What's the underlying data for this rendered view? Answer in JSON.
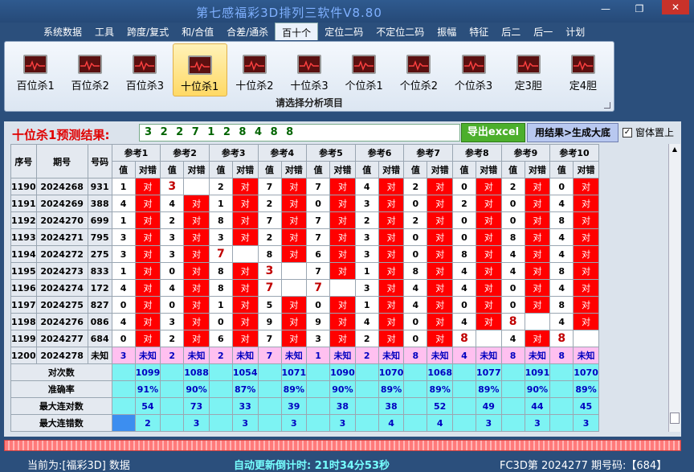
{
  "window": {
    "title": "第七感福彩3D排列三软件V8.80"
  },
  "menu": [
    "系统数据",
    "工具",
    "跨度/复式",
    "和/合值",
    "合差/通杀",
    "百十个",
    "定位二码",
    "不定位二码",
    "振幅",
    "特征",
    "后二",
    "后一",
    "计划"
  ],
  "menu_active": "百十个",
  "ribbon": {
    "buttons": [
      "百位杀1",
      "百位杀2",
      "百位杀3",
      "十位杀1",
      "十位杀2",
      "十位杀3",
      "个位杀1",
      "个位杀2",
      "个位杀3",
      "定3胆",
      "定4胆"
    ],
    "active": "十位杀1",
    "caption": "请选择分析项目"
  },
  "result": {
    "title": "十位杀1预测结果:",
    "value": "3 2 2 7 1 2 8 4 8 8",
    "export_label": "导出excel",
    "generate_label": "用结果>生成大底",
    "ontop_label": "窗体置上",
    "ontop_checked": true
  },
  "table": {
    "headers": {
      "seq": "序号",
      "period": "期号",
      "number": "号码",
      "value": "值",
      "result": "对错"
    },
    "refs": [
      "参考1",
      "参考2",
      "参考3",
      "参考4",
      "参考5",
      "参考6",
      "参考7",
      "参考8",
      "参考9",
      "参考10"
    ],
    "rows": [
      {
        "seq": "1190",
        "period": "2024268",
        "number": "931",
        "vals": [
          "1",
          "3",
          "2",
          "7",
          "7",
          "4",
          "2",
          "0",
          "2",
          "0"
        ]
      },
      {
        "seq": "1191",
        "period": "2024269",
        "number": "388",
        "vals": [
          "4",
          "4",
          "1",
          "2",
          "0",
          "3",
          "0",
          "2",
          "0",
          "4"
        ]
      },
      {
        "seq": "1192",
        "period": "2024270",
        "number": "699",
        "vals": [
          "1",
          "2",
          "8",
          "7",
          "7",
          "2",
          "2",
          "0",
          "0",
          "8"
        ]
      },
      {
        "seq": "1193",
        "period": "2024271",
        "number": "795",
        "vals": [
          "3",
          "3",
          "3",
          "2",
          "7",
          "3",
          "0",
          "0",
          "8",
          "4"
        ]
      },
      {
        "seq": "1194",
        "period": "2024272",
        "number": "275",
        "vals": [
          "3",
          "3",
          "7",
          "8",
          "6",
          "3",
          "0",
          "8",
          "4",
          "4"
        ]
      },
      {
        "seq": "1195",
        "period": "2024273",
        "number": "833",
        "vals": [
          "1",
          "0",
          "8",
          "3",
          "7",
          "1",
          "8",
          "4",
          "4",
          "8"
        ]
      },
      {
        "seq": "1196",
        "period": "2024274",
        "number": "172",
        "vals": [
          "4",
          "4",
          "8",
          "7",
          "7",
          "3",
          "4",
          "4",
          "0",
          "4"
        ]
      },
      {
        "seq": "1197",
        "period": "2024275",
        "number": "827",
        "vals": [
          "0",
          "0",
          "1",
          "5",
          "0",
          "1",
          "4",
          "0",
          "0",
          "8"
        ]
      },
      {
        "seq": "1198",
        "period": "2024276",
        "number": "086",
        "vals": [
          "4",
          "3",
          "0",
          "9",
          "9",
          "4",
          "0",
          "4",
          "8",
          "4"
        ]
      },
      {
        "seq": "1199",
        "period": "2024277",
        "number": "684",
        "vals": [
          "0",
          "2",
          "6",
          "7",
          "3",
          "2",
          "0",
          "8",
          "4",
          "8"
        ]
      }
    ],
    "pred_row": {
      "seq": "1200",
      "period": "2024278",
      "number": "未知",
      "vals": [
        "3",
        "2",
        "2",
        "7",
        "1",
        "2",
        "8",
        "4",
        "8",
        "8"
      ],
      "unknown": "未知"
    },
    "red_label": "对",
    "stats": {
      "labels": [
        "对次数",
        "准确率",
        "最大连对数",
        "最大连错数"
      ],
      "hits": [
        "1099",
        "1088",
        "1054",
        "1071",
        "1090",
        "1070",
        "1068",
        "1077",
        "1091",
        "1070"
      ],
      "accuracy": [
        "91%",
        "90%",
        "87%",
        "89%",
        "90%",
        "89%",
        "89%",
        "89%",
        "90%",
        "89%"
      ],
      "max_hit_streak": [
        "54",
        "73",
        "33",
        "39",
        "38",
        "38",
        "52",
        "49",
        "44",
        "45"
      ],
      "max_miss_streak": [
        "2",
        "3",
        "3",
        "3",
        "3",
        "4",
        "4",
        "3",
        "3",
        "3"
      ]
    }
  },
  "status": {
    "current": "当前为:[福彩3D] 数据",
    "countdown": "自动更新倒计时: 21时34分53秒",
    "period": "FC3D第 2024277 期号码:【684】"
  }
}
